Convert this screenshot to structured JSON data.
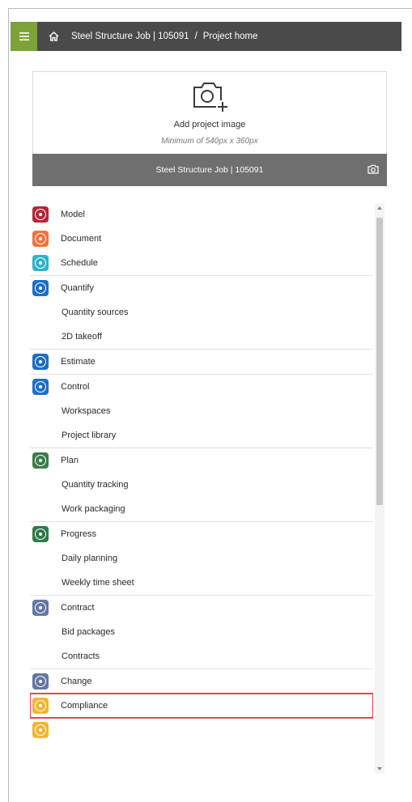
{
  "breadcrumb": {
    "job": "Steel Structure Job | 105091",
    "separator": "/",
    "page": "Project home"
  },
  "image_card": {
    "add_label": "Add project image",
    "min_size": "Minimum of 540px x 360px",
    "project_name": "Steel Structure Job | 105091"
  },
  "menu": {
    "model": "Model",
    "document": "Document",
    "schedule": "Schedule",
    "quantify": "Quantify",
    "quantity_sources": "Quantity sources",
    "takeoff_2d": "2D takeoff",
    "estimate": "Estimate",
    "control": "Control",
    "workspaces": "Workspaces",
    "project_library": "Project library",
    "plan": "Plan",
    "quantity_tracking": "Quantity tracking",
    "work_packaging": "Work packaging",
    "progress": "Progress",
    "daily_planning": "Daily planning",
    "weekly_time_sheet": "Weekly time sheet",
    "contract": "Contract",
    "bid_packages": "Bid packages",
    "contracts": "Contracts",
    "change": "Change",
    "compliance": "Compliance"
  },
  "colors": {
    "topbar": "#4a4a4a",
    "menu_button": "#7da23a",
    "model": "#b3263a",
    "document": "#f0733a",
    "schedule": "#2fb3c9",
    "quantify": "#1d6fc4",
    "estimate": "#1d6fc4",
    "control": "#1d6fc4",
    "plan": "#3a7d4b",
    "progress": "#2f7a4a",
    "contract": "#6677a4",
    "change": "#6677a4",
    "compliance": "#f2b632",
    "highlight": "#e04a4a"
  },
  "icons": {
    "menu": "hamburger-icon",
    "home": "home-icon",
    "camera_add": "camera-add-icon",
    "camera": "camera-icon"
  }
}
